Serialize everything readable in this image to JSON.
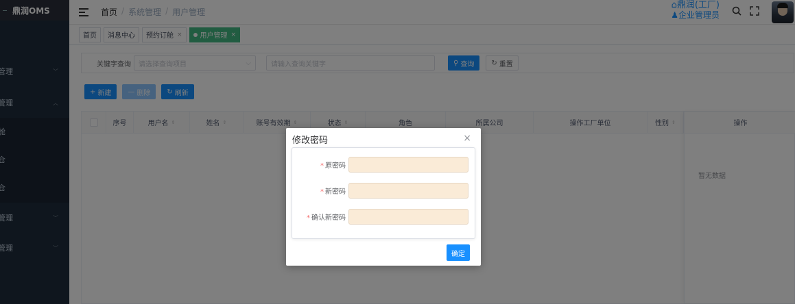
{
  "sidebar": {
    "logo": "鼎润OMS",
    "items": [
      {
        "label": "管理",
        "chevron": "﹀"
      },
      {
        "label": "管理",
        "chevron": "︿"
      },
      {
        "label": "舱"
      },
      {
        "label": "仓"
      },
      {
        "label": "仓"
      },
      {
        "label": "管理",
        "chevron": "﹀"
      },
      {
        "label": "管理",
        "chevron": "﹀"
      }
    ]
  },
  "header": {
    "breadcrumb": [
      "首页",
      "系统管理",
      "用户管理"
    ],
    "breadcrumb_sep": "/",
    "company": "鼎润(工厂)",
    "role": "企业管理员",
    "icons": [
      "search-icon",
      "fullscreen-icon"
    ]
  },
  "tags": [
    {
      "label": "首页"
    },
    {
      "label": "消息中心"
    },
    {
      "label": "预约订舱",
      "close": "×"
    },
    {
      "label": "用户管理",
      "close": "×",
      "active": true
    }
  ],
  "search": {
    "label": "关键字查询",
    "select_placeholder": "请选择查询项目",
    "keyword_placeholder": "请输入查询关键字",
    "query_btn": "查询",
    "reset_btn": "重置"
  },
  "actions": {
    "new_btn": "新建",
    "delete_btn": "删除",
    "refresh_btn": "刷新"
  },
  "table": {
    "columns": [
      {
        "label": "序号"
      },
      {
        "label": "用户名",
        "sortable": true
      },
      {
        "label": "姓名",
        "sortable": true
      },
      {
        "label": "账号有效期",
        "sortable": true
      },
      {
        "label": "状态",
        "sortable": true
      },
      {
        "label": "角色"
      },
      {
        "label": "所属公司"
      },
      {
        "label": "操作工厂单位"
      },
      {
        "label": "性别",
        "sortable": true
      }
    ],
    "op_column": "操作",
    "empty_text": "暂无数据",
    "sort_glyph": "⇕"
  },
  "dialog": {
    "title": "修改密码",
    "close": "×",
    "required_mark": "*",
    "fields": [
      {
        "label": "原密码",
        "value": ""
      },
      {
        "label": "新密码",
        "value": ""
      },
      {
        "label": "确认新密码",
        "value": ""
      }
    ],
    "confirm_btn": "确定"
  },
  "colors": {
    "primary": "#1890ff",
    "tag_active": "#42b983",
    "sidebar_bg": "#1f2d3d",
    "input_fill": "#faebd7"
  }
}
